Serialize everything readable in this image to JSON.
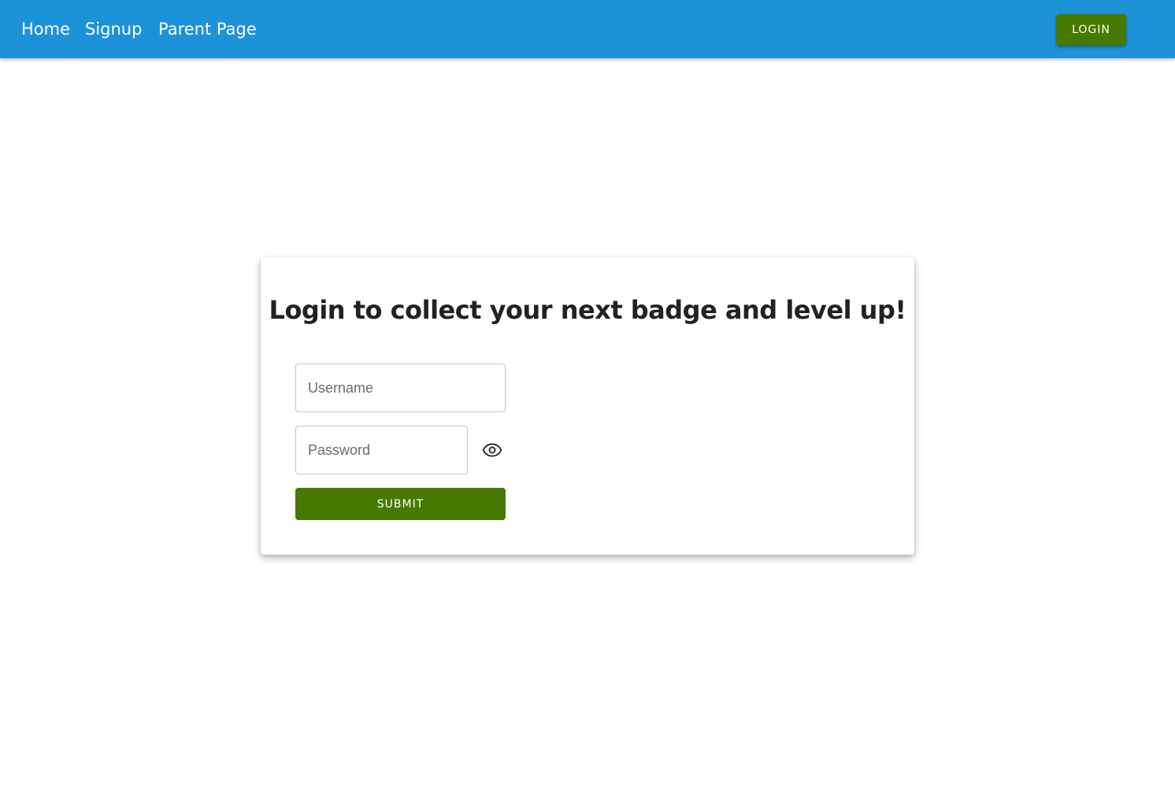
{
  "nav": {
    "links": [
      {
        "label": "Home"
      },
      {
        "label": "Signup"
      },
      {
        "label": "Parent Page"
      }
    ],
    "login_label": "LOGIN"
  },
  "login_card": {
    "title": "Login to collect your next badge and level up!",
    "username": {
      "placeholder": "Username",
      "value": ""
    },
    "password": {
      "placeholder": "Password",
      "value": ""
    },
    "toggle_visibility_icon": "eye-icon",
    "submit_label": "SUBMIT"
  },
  "colors": {
    "navbar_bg": "#1e92d8",
    "accent_green": "#477800",
    "title_text": "#222222"
  }
}
